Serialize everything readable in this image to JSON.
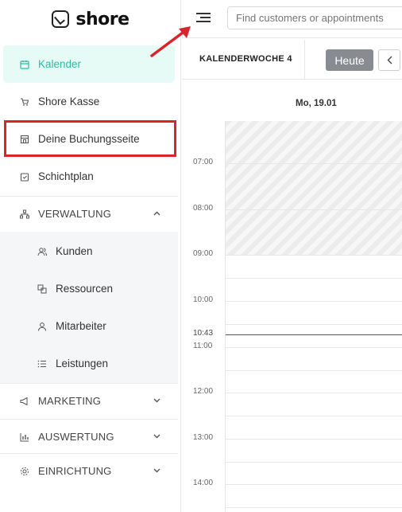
{
  "brand": {
    "name": "shore"
  },
  "sidebar": {
    "items": [
      {
        "label": "Kalender",
        "icon": "calendar-icon",
        "active": true
      },
      {
        "label": "Shore Kasse",
        "icon": "cart-icon"
      },
      {
        "label": "Deine Buchungsseite",
        "icon": "store-icon"
      },
      {
        "label": "Schichtplan",
        "icon": "schedule-icon"
      }
    ],
    "sections": [
      {
        "label": "VERWALTUNG",
        "icon": "sitemap-icon",
        "expanded": true,
        "children": [
          {
            "label": "Kunden",
            "icon": "users-icon"
          },
          {
            "label": "Ressourcen",
            "icon": "resources-icon"
          },
          {
            "label": "Mitarbeiter",
            "icon": "person-icon"
          },
          {
            "label": "Leistungen",
            "icon": "list-icon"
          }
        ]
      },
      {
        "label": "MARKETING",
        "icon": "megaphone-icon",
        "expanded": false
      },
      {
        "label": "AUSWERTUNG",
        "icon": "bar-chart-icon",
        "expanded": false
      },
      {
        "label": "EINRICHTUNG",
        "icon": "gear-icon",
        "expanded": false
      }
    ]
  },
  "topbar": {
    "search_placeholder": "Find customers or appointments"
  },
  "calendar": {
    "week_label": "KALENDERWOCHE 4",
    "today_label": "Heute",
    "day_header": "Mo, 19.01",
    "times": [
      "07:00",
      "08:00",
      "09:00",
      "10:00",
      "11:00",
      "12:00",
      "13:00",
      "14:00"
    ],
    "now_time": "10:43"
  },
  "colors": {
    "accent": "#2fb9a1",
    "active_bg": "#e6fbf6",
    "highlight": "#d9242c",
    "today_btn": "#888c90"
  }
}
